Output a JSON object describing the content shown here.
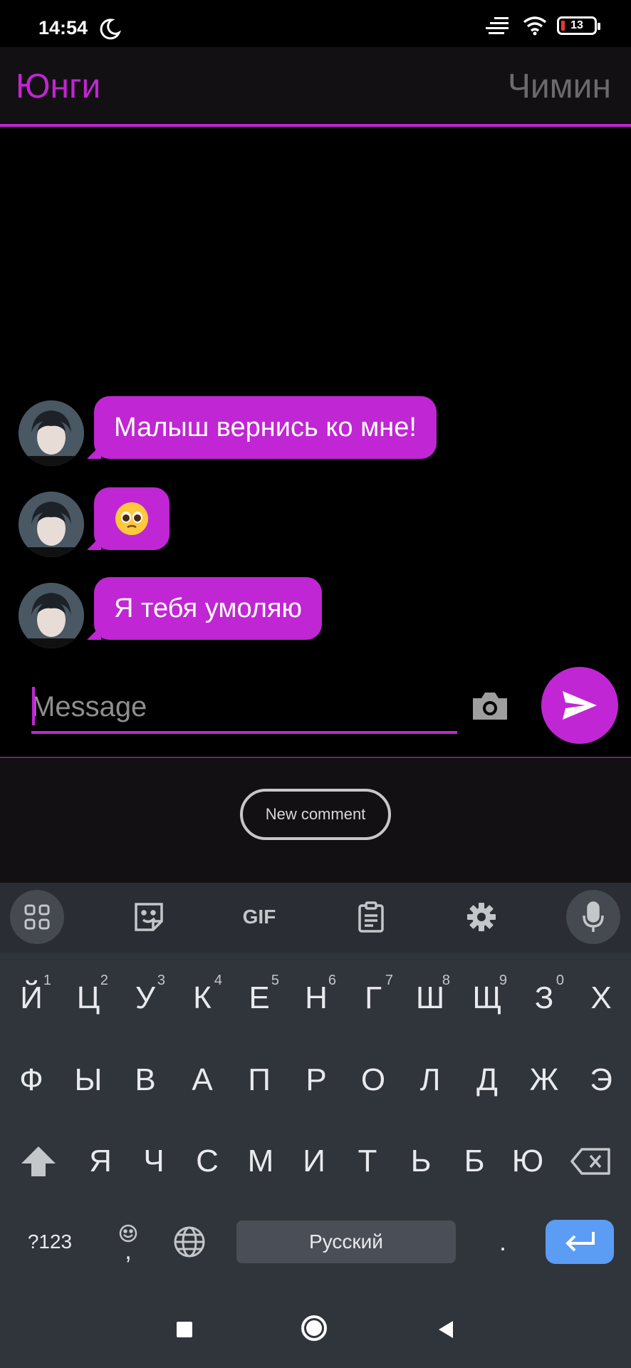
{
  "status_bar": {
    "time": "14:54",
    "battery": "13"
  },
  "header": {
    "left_name": "Юнги",
    "right_name": "Чимин"
  },
  "messages": [
    {
      "text": "Малыш вернись ко мне!"
    },
    {
      "text": "",
      "emoji": "pleading-face"
    },
    {
      "text": "Я тебя умоляю"
    }
  ],
  "composer": {
    "placeholder": "Message"
  },
  "panel": {
    "new_comment": "New comment"
  },
  "keyboard": {
    "tools": [
      "apps-grid-icon",
      "sticker-icon",
      "GIF",
      "clipboard-icon",
      "settings-icon",
      "mic-icon"
    ],
    "gif_label": "GIF",
    "row1": [
      {
        "k": "Й",
        "n": "1"
      },
      {
        "k": "Ц",
        "n": "2"
      },
      {
        "k": "У",
        "n": "3"
      },
      {
        "k": "К",
        "n": "4"
      },
      {
        "k": "Е",
        "n": "5"
      },
      {
        "k": "Н",
        "n": "6"
      },
      {
        "k": "Г",
        "n": "7"
      },
      {
        "k": "Ш",
        "n": "8"
      },
      {
        "k": "Щ",
        "n": "9"
      },
      {
        "k": "З",
        "n": "0"
      },
      {
        "k": "Х",
        "n": ""
      }
    ],
    "row2": [
      "Ф",
      "Ы",
      "В",
      "А",
      "П",
      "Р",
      "О",
      "Л",
      "Д",
      "Ж",
      "Э"
    ],
    "row3": [
      "Я",
      "Ч",
      "С",
      "М",
      "И",
      "Т",
      "Ь",
      "Б",
      "Ю"
    ],
    "symbols_label": "?123",
    "comma_label": ",",
    "space_label": "Русский",
    "period_label": "."
  },
  "colors": {
    "accent": "#c026d3",
    "enter": "#5b9cf5"
  }
}
